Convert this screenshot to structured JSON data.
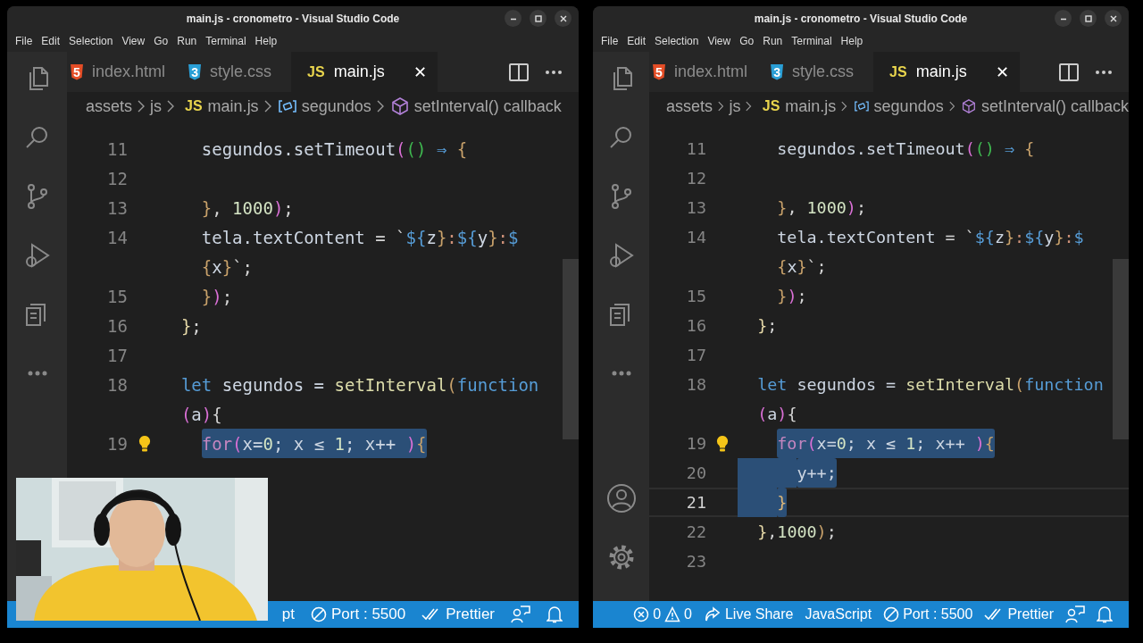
{
  "windows": [
    {
      "title": "main.js - cronometro - Visual Studio Code",
      "menu": [
        "File",
        "Edit",
        "Selection",
        "View",
        "Go",
        "Run",
        "Terminal",
        "Help"
      ],
      "activity": [
        {
          "kind": "files"
        },
        {
          "kind": "search"
        },
        {
          "kind": "scm"
        },
        {
          "kind": "debug"
        },
        {
          "kind": "remote"
        },
        {
          "kind": "more"
        }
      ],
      "tabs": [
        {
          "kind": "html",
          "badge": "5",
          "label": "index.html",
          "selected": false
        },
        {
          "kind": "css",
          "badge": "3",
          "label": "style.css",
          "selected": false
        },
        {
          "kind": "js",
          "badge": "JS",
          "label": "main.js",
          "selected": true,
          "close": "✕"
        }
      ],
      "breadcrumbs": [
        {
          "kind": "folder",
          "label": "assets"
        },
        {
          "kind": "folder",
          "label": "js"
        },
        {
          "kind": "js",
          "badge": "JS",
          "label": "main.js"
        },
        {
          "kind": "variable",
          "label": "segundos"
        },
        {
          "kind": "method",
          "label": "setInterval() callback"
        }
      ],
      "lines": [
        {
          "number": "11",
          "tokens": [
            {
              "text": "    segundos.setTimeout",
              "color": "#cdd6e2"
            },
            {
              "text": "(",
              "color": "#da70d6"
            },
            {
              "text": "()",
              "color": "#3fb950"
            },
            {
              "text": " ⇒ ",
              "color": "#569cd6"
            },
            {
              "text": "{",
              "color": "#c9a26b"
            }
          ],
          "selected": false,
          "current": false
        },
        {
          "number": "12",
          "current": false
        },
        {
          "number": "13",
          "tokens": [
            {
              "text": "    }",
              "color": "#c9a26b"
            },
            {
              "text": ", ",
              "color": "#d4d4d4"
            },
            {
              "text": "1000",
              "color": "#d4e4c4"
            },
            {
              "text": ")",
              "color": "#da70d6"
            },
            {
              "text": ";",
              "color": "#d4d4d4"
            }
          ],
          "selected": false,
          "current": false
        },
        {
          "number": "14",
          "tokens": [
            {
              "text": "    tela.textContent",
              "color": "#cdd6e2"
            },
            {
              "text": " = `",
              "color": "#d4d4d4"
            },
            {
              "text": "${",
              "color": "#569cd6"
            },
            {
              "text": "z",
              "color": "#cdd6e2"
            },
            {
              "text": "}",
              "color": "#c9a26b"
            },
            {
              "text": ":",
              "color": "#ce9178"
            },
            {
              "text": "${",
              "color": "#569cd6"
            },
            {
              "text": "y",
              "color": "#cdd6e2"
            },
            {
              "text": "}",
              "color": "#c9a26b"
            },
            {
              "text": ":",
              "color": "#ce9178"
            },
            {
              "text": "$",
              "color": "#569cd6"
            }
          ],
          "selected": false,
          "current": false
        },
        {
          "tokens": [
            {
              "text": "    {",
              "color": "#c9a26b"
            },
            {
              "text": "x",
              "color": "#cdd6e2"
            },
            {
              "text": "}",
              "color": "#c9a26b"
            },
            {
              "text": "`;",
              "color": "#d4d4d4"
            }
          ],
          "selected": false,
          "current": false
        },
        {
          "number": "15",
          "tokens": [
            {
              "text": "    }",
              "color": "#c9a26b"
            },
            {
              "text": ")",
              "color": "#da70d6"
            },
            {
              "text": ";",
              "color": "#d4d4d4"
            }
          ],
          "selected": false,
          "current": false
        },
        {
          "number": "16",
          "tokens": [
            {
              "text": "  }",
              "color": "#e6d9a8"
            },
            {
              "text": ";",
              "color": "#d4d4d4"
            }
          ],
          "selected": false,
          "current": false
        },
        {
          "number": "17",
          "current": false
        },
        {
          "number": "18",
          "tokens": [
            {
              "text": "  let",
              "color": "#569cd6"
            },
            {
              "text": " segundos = ",
              "color": "#cdd6e2"
            },
            {
              "text": "setInterval",
              "color": "#dcdcaa"
            },
            {
              "text": "(",
              "color": "#c9a26b"
            },
            {
              "text": "function",
              "color": "#569cd6"
            }
          ],
          "selected": false,
          "current": false
        },
        {
          "tokens": [
            {
              "text": "  (",
              "color": "#da70d6"
            },
            {
              "text": "a",
              "color": "#cdd6e2"
            },
            {
              "text": ")",
              "color": "#da70d6"
            },
            {
              "text": "{",
              "color": "#d4d4d4"
            }
          ],
          "selected": false,
          "current": false
        },
        {
          "number": "19",
          "lightbulb": true,
          "tokens": [
            {
              "text": "    for",
              "color": "#c586c0"
            },
            {
              "text": "(",
              "color": "#da70d6"
            },
            {
              "text": "x=",
              "color": "#cdd6e2"
            },
            {
              "text": "0",
              "color": "#d4e4c4"
            },
            {
              "text": "; x ≤ ",
              "color": "#cdd6e2"
            },
            {
              "text": "1",
              "color": "#d4e4c4"
            },
            {
              "text": "; x++ ",
              "color": "#cdd6e2"
            },
            {
              "text": ")",
              "color": "#da70d6"
            },
            {
              "text": "{",
              "color": "#c9a26b"
            }
          ],
          "selected": true,
          "current": false
        }
      ],
      "status": [
        {
          "kind": "language",
          "text": "pt"
        },
        {
          "kind": "port",
          "text": "Port : 5500"
        },
        {
          "kind": "prettier",
          "text": "Prettier"
        },
        {
          "kind": "feedback"
        },
        {
          "kind": "bell"
        }
      ]
    },
    {
      "title": "main.js - cronometro - Visual Studio Code",
      "menu": [
        "File",
        "Edit",
        "Selection",
        "View",
        "Go",
        "Run",
        "Terminal",
        "Help"
      ],
      "activity": [
        {
          "kind": "files"
        },
        {
          "kind": "search"
        },
        {
          "kind": "scm"
        },
        {
          "kind": "debug"
        },
        {
          "kind": "remote"
        },
        {
          "kind": "more"
        },
        {
          "kind": "account"
        },
        {
          "kind": "gear"
        }
      ],
      "tabs": [
        {
          "kind": "html",
          "badge": "5",
          "label": "index.html",
          "selected": false
        },
        {
          "kind": "css",
          "badge": "3",
          "label": "style.css",
          "selected": false
        },
        {
          "kind": "js",
          "badge": "JS",
          "label": "main.js",
          "selected": true,
          "close": "✕"
        }
      ],
      "breadcrumbs": [
        {
          "kind": "folder",
          "label": "assets"
        },
        {
          "kind": "folder",
          "label": "js"
        },
        {
          "kind": "js",
          "badge": "JS",
          "label": "main.js"
        },
        {
          "kind": "variable",
          "label": "segundos"
        },
        {
          "kind": "method",
          "label": "setInterval() callback"
        }
      ],
      "lines": [
        {
          "number": "11",
          "tokens": [
            {
              "text": "    segundos.setTimeout",
              "color": "#cdd6e2"
            },
            {
              "text": "(",
              "color": "#da70d6"
            },
            {
              "text": "()",
              "color": "#3fb950"
            },
            {
              "text": " ⇒ ",
              "color": "#569cd6"
            },
            {
              "text": "{",
              "color": "#c9a26b"
            }
          ],
          "selected": false,
          "current": false
        },
        {
          "number": "12",
          "current": false
        },
        {
          "number": "13",
          "tokens": [
            {
              "text": "    }",
              "color": "#c9a26b"
            },
            {
              "text": ", ",
              "color": "#d4d4d4"
            },
            {
              "text": "1000",
              "color": "#d4e4c4"
            },
            {
              "text": ")",
              "color": "#da70d6"
            },
            {
              "text": ";",
              "color": "#d4d4d4"
            }
          ],
          "selected": false,
          "current": false
        },
        {
          "number": "14",
          "tokens": [
            {
              "text": "    tela.textContent",
              "color": "#cdd6e2"
            },
            {
              "text": " = `",
              "color": "#d4d4d4"
            },
            {
              "text": "${",
              "color": "#569cd6"
            },
            {
              "text": "z",
              "color": "#cdd6e2"
            },
            {
              "text": "}",
              "color": "#c9a26b"
            },
            {
              "text": ":",
              "color": "#ce9178"
            },
            {
              "text": "${",
              "color": "#569cd6"
            },
            {
              "text": "y",
              "color": "#cdd6e2"
            },
            {
              "text": "}",
              "color": "#c9a26b"
            },
            {
              "text": ":",
              "color": "#ce9178"
            },
            {
              "text": "$",
              "color": "#569cd6"
            }
          ],
          "selected": false,
          "current": false
        },
        {
          "tokens": [
            {
              "text": "    {",
              "color": "#c9a26b"
            },
            {
              "text": "x",
              "color": "#cdd6e2"
            },
            {
              "text": "}",
              "color": "#c9a26b"
            },
            {
              "text": "`;",
              "color": "#d4d4d4"
            }
          ],
          "selected": false,
          "current": false
        },
        {
          "number": "15",
          "tokens": [
            {
              "text": "    }",
              "color": "#c9a26b"
            },
            {
              "text": ")",
              "color": "#da70d6"
            },
            {
              "text": ";",
              "color": "#d4d4d4"
            }
          ],
          "selected": false,
          "current": false
        },
        {
          "number": "16",
          "tokens": [
            {
              "text": "  }",
              "color": "#e6d9a8"
            },
            {
              "text": ";",
              "color": "#d4d4d4"
            }
          ],
          "selected": false,
          "current": false
        },
        {
          "number": "17",
          "current": false
        },
        {
          "number": "18",
          "tokens": [
            {
              "text": "  let",
              "color": "#569cd6"
            },
            {
              "text": " segundos = ",
              "color": "#cdd6e2"
            },
            {
              "text": "setInterval",
              "color": "#dcdcaa"
            },
            {
              "text": "(",
              "color": "#c9a26b"
            },
            {
              "text": "function",
              "color": "#569cd6"
            }
          ],
          "selected": false,
          "current": false
        },
        {
          "tokens": [
            {
              "text": "  (",
              "color": "#da70d6"
            },
            {
              "text": "a",
              "color": "#cdd6e2"
            },
            {
              "text": ")",
              "color": "#da70d6"
            },
            {
              "text": "{",
              "color": "#d4d4d4"
            }
          ],
          "selected": false,
          "current": false
        },
        {
          "number": "19",
          "lightbulb": true,
          "tokens": [
            {
              "text": "    for",
              "color": "#c586c0"
            },
            {
              "text": "(",
              "color": "#da70d6"
            },
            {
              "text": "x=",
              "color": "#cdd6e2"
            },
            {
              "text": "0",
              "color": "#d4e4c4"
            },
            {
              "text": "; x ≤ ",
              "color": "#cdd6e2"
            },
            {
              "text": "1",
              "color": "#d4e4c4"
            },
            {
              "text": "; x++ ",
              "color": "#cdd6e2"
            },
            {
              "text": ")",
              "color": "#da70d6"
            },
            {
              "text": "{",
              "color": "#c9a26b"
            }
          ],
          "selected": true,
          "current": false
        },
        {
          "number": "20",
          "tokens": [
            {
              "text": "      y++;",
              "color": "#cdd6e2"
            }
          ],
          "selected": true,
          "current": false
        },
        {
          "number": "21",
          "tokens": [
            {
              "text": "    }",
              "color": "#e0b878"
            }
          ],
          "selected": true,
          "current": true
        },
        {
          "number": "22",
          "tokens": [
            {
              "text": "  }",
              "color": "#e6d9a8"
            },
            {
              "text": ",",
              "color": "#d4d4d4"
            },
            {
              "text": "1000",
              "color": "#d4e4c4"
            },
            {
              "text": ")",
              "color": "#c9a26b"
            },
            {
              "text": ";",
              "color": "#d4d4d4"
            }
          ],
          "selected": false,
          "current": false
        },
        {
          "number": "23",
          "current": false
        }
      ],
      "status": [
        {
          "kind": "problems",
          "errors": "0",
          "warnings": "0"
        },
        {
          "kind": "liveshare",
          "text": "Live Share"
        },
        {
          "kind": "language",
          "text": "JavaScript"
        },
        {
          "kind": "port",
          "text": "Port : 5500"
        },
        {
          "kind": "prettier",
          "text": "Prettier"
        },
        {
          "kind": "feedback"
        },
        {
          "kind": "bell"
        }
      ]
    }
  ]
}
